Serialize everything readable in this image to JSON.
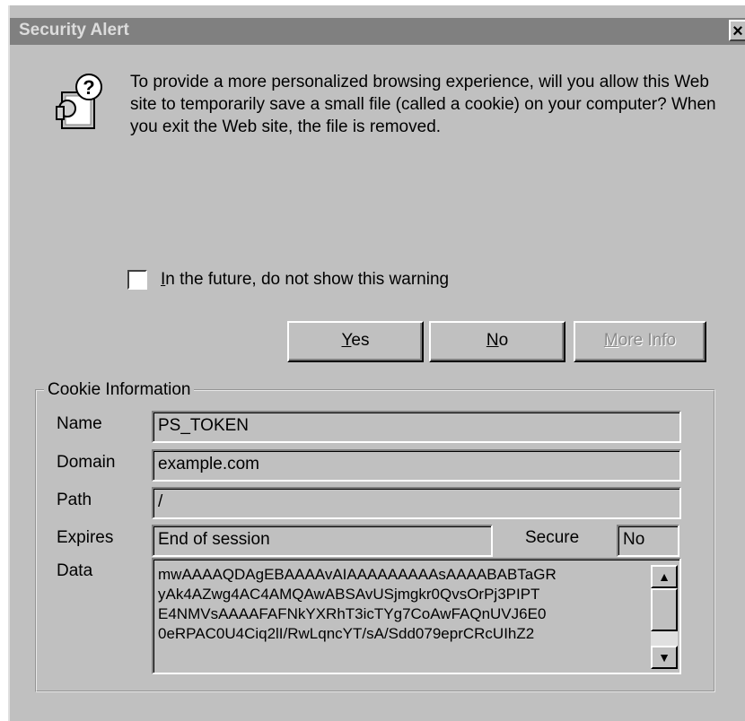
{
  "window": {
    "title": "Security Alert",
    "close_glyph": "✕"
  },
  "icons": {
    "alert": "security-question-icon",
    "close": "close-icon",
    "scroll_up": "arrow-up-icon",
    "scroll_down": "arrow-down-icon"
  },
  "message": "To provide a more personalized browsing experience, will you allow this Web site to temporarily save a small file (called a cookie) on your computer?   When you exit the Web site, the file is removed.",
  "checkbox": {
    "label": "In the future, do not show this warning",
    "checked": false
  },
  "buttons": {
    "yes": "Yes",
    "no": "No",
    "more_info": "More Info",
    "more_info_enabled": false
  },
  "cookie_info": {
    "legend": "Cookie Information",
    "name_label": "Name",
    "name_value": "PS_TOKEN",
    "domain_label": "Domain",
    "domain_value": "example.com",
    "path_label": "Path",
    "path_value": "/",
    "expires_label": "Expires",
    "expires_value": "End of session",
    "secure_label": "Secure",
    "secure_value": "No",
    "data_label": "Data",
    "data_lines": [
      "mwAAAAQDAgEBAAAAvAIAAAAAAAAAsAAAABABTaGR",
      "yAk4AZwg4AC4AMQAwABSAvUSjmgkr0QvsOrPj3PIPT",
      "E4NMVsAAAAFAFNkYXRhT3icTYg7CoAwFAQnUVJ6E0",
      "0eRPAC0U4Ciq2lI/RwLqncYT/sA/Sdd079eprCRcUIhZ2"
    ]
  }
}
